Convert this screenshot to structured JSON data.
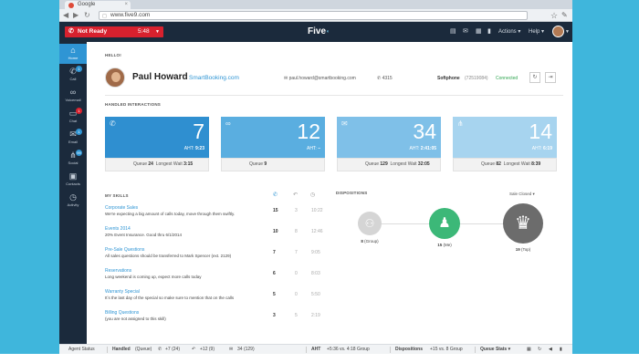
{
  "browser": {
    "tab_title": "Google",
    "url": "www.five9.com"
  },
  "topnav": {
    "status": {
      "label": "Not Ready",
      "timer": "5:48"
    },
    "logo": "Five",
    "actions_label": "Actions",
    "help_label": "Help"
  },
  "sidenav": [
    {
      "label": "Home",
      "icon": "home-icon",
      "badge": ""
    },
    {
      "label": "Call",
      "icon": "phone-icon",
      "badge": "1"
    },
    {
      "label": "Voicemail",
      "icon": "voicemail-icon",
      "badge": ""
    },
    {
      "label": "Chat",
      "icon": "chat-icon",
      "badge": "1"
    },
    {
      "label": "Email",
      "icon": "email-icon",
      "badge": "1"
    },
    {
      "label": "Social",
      "icon": "social-icon",
      "badge": "99"
    },
    {
      "label": "Contacts",
      "icon": "contacts-icon",
      "badge": ""
    },
    {
      "label": "Activity",
      "icon": "activity-icon",
      "badge": ""
    }
  ],
  "greeting": "HELLO!",
  "user": {
    "name": "Paul Howard",
    "company": "SmartBooking.com",
    "email": "paul.howard@smartbooking.com",
    "extension": "4315",
    "softphone_label": "Softphone",
    "softphone_number": "(72519084)",
    "softphone_status": "Connected"
  },
  "handled_title": "HANDLED INTERACTIONS",
  "cards": [
    {
      "icon": "phone-icon",
      "count": "7",
      "aht": "9:23",
      "queue": "24",
      "longest_wait": "3:15",
      "color": "#2f8fd0"
    },
    {
      "icon": "voicemail-icon",
      "count": "12",
      "aht": "–",
      "queue": "9",
      "longest_wait": "",
      "color": "#5aaee0"
    },
    {
      "icon": "email-icon",
      "count": "34",
      "aht": "2:41:05",
      "queue": "129",
      "longest_wait": "32:05",
      "color": "#7fc0e8"
    },
    {
      "icon": "social-icon",
      "count": "14",
      "aht": "6:19",
      "queue": "82",
      "longest_wait": "8:39",
      "color": "#a7d4ef"
    }
  ],
  "card_labels": {
    "aht": "AHT:",
    "queue": "Queue",
    "longest_wait": "Longest Wait"
  },
  "skills": {
    "title": "MY SKILLS",
    "rows": [
      {
        "name": "Corporate Sales",
        "desc": "We're expecting a big amount of calls today, move through them swiftly.",
        "calls": "15",
        "vm": "3",
        "time": "10:22"
      },
      {
        "name": "Events 2014",
        "desc": "20% Event Insurance. Good thru 6/1/2014",
        "calls": "10",
        "vm": "8",
        "time": "12:46"
      },
      {
        "name": "Pre-Sale Questions",
        "desc": "All sales questions should be transferred to Mark Spencer (ext. 2129)",
        "calls": "7",
        "vm": "7",
        "time": "9:05"
      },
      {
        "name": "Reservations",
        "desc": "Long weekend is coming up, expect more calls today",
        "calls": "6",
        "vm": "0",
        "time": "8:03"
      },
      {
        "name": "Warranty Special",
        "desc": "Itʼs the last day of the special so make sure to mention that on the calls",
        "calls": "5",
        "vm": "0",
        "time": "5:50"
      },
      {
        "name": "Billing Questions",
        "desc": "(you are not assigned to this skill)",
        "calls": "3",
        "vm": "5",
        "time": "2:19"
      }
    ]
  },
  "dispositions": {
    "title": "DISPOSITIONS",
    "filter": "Sale Closed",
    "items": [
      {
        "value": "8",
        "label": "(Group)",
        "icon": "group-icon",
        "color": "#d5d5d5"
      },
      {
        "value": "15",
        "label": "(Me)",
        "icon": "user-icon",
        "color": "#3cb878"
      },
      {
        "value": "19",
        "label": "(Top)",
        "icon": "trophy-icon",
        "color": "#6c6c6c"
      }
    ]
  },
  "statusbar": {
    "agent_status": "Agent Status",
    "handled": "Handled",
    "handled_queue": "(Queue)",
    "calls": "+7 (24)",
    "vm": "+12 (9)",
    "email": "34 (129)",
    "aht_label": "AHT",
    "aht_value": "+5:36 vs. 4:18 Group",
    "dispositions_label": "Dispositions",
    "dispositions_value": "+15 vs. 8 Group",
    "queue_stats": "Queue Stats"
  }
}
